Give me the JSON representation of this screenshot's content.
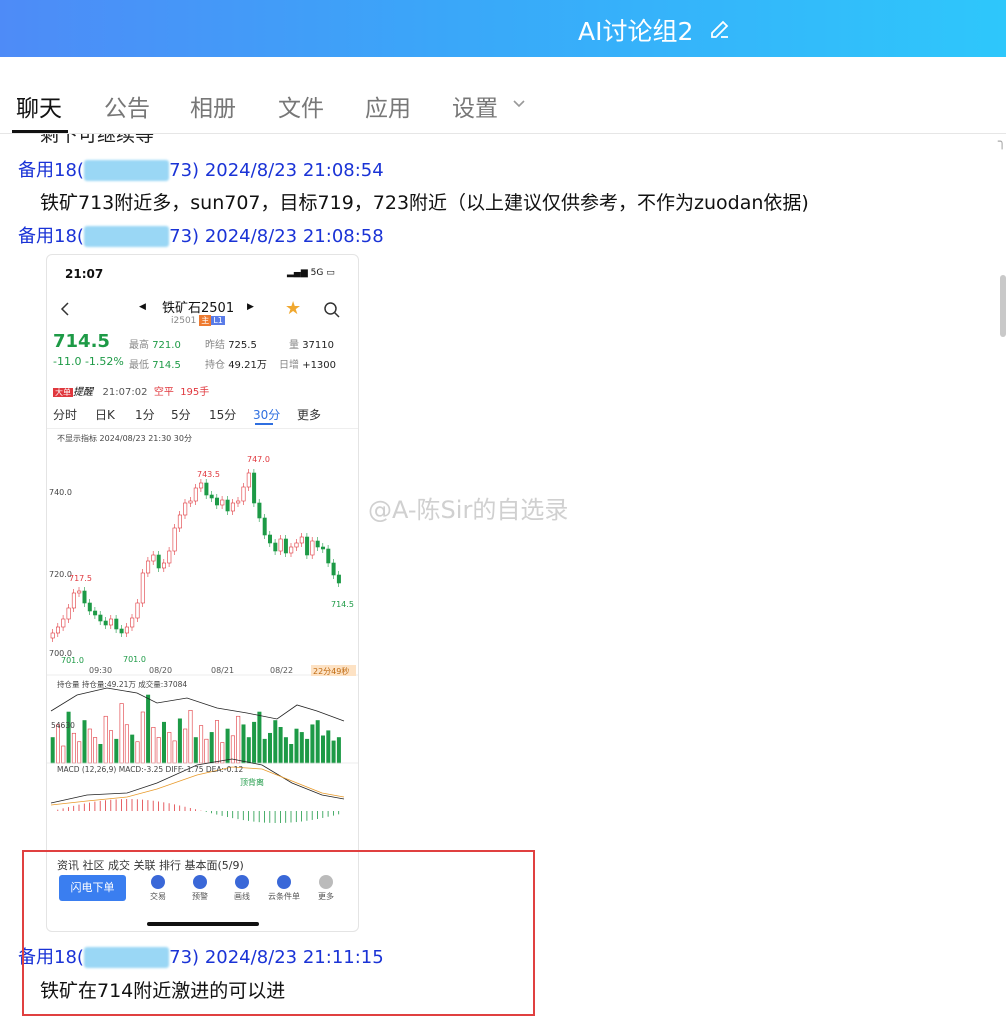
{
  "window": {
    "title": "AI讨论组2"
  },
  "tabs": [
    {
      "label": "聊天"
    },
    {
      "label": "公告"
    },
    {
      "label": "相册"
    },
    {
      "label": "文件"
    },
    {
      "label": "应用"
    },
    {
      "label": "设置"
    }
  ],
  "messages": [
    {
      "cut_text": "剩下可继续等"
    },
    {
      "sender_prefix": "备用18(",
      "sender_id_tail": "73)",
      "time": "2024/8/23 21:08:54",
      "text": "铁矿713附近多，sun707，目标719，723附近（以上建议仅供参考，不作为zuodan依据)"
    },
    {
      "sender_prefix": "备用18(",
      "sender_id_tail": "73)",
      "time": "2024/8/23 21:08:58"
    },
    {
      "sender_prefix": "备用18(",
      "sender_id_tail": "73)",
      "time": "2024/8/23 21:11:15",
      "text": "铁矿在714附近激进的可以进"
    }
  ],
  "phone": {
    "time": "21:07",
    "status_right": "5G",
    "symbol": "铁矿石2501",
    "code": "i2501",
    "code_tag1": "主",
    "code_tag2": "L1",
    "price": "714.5",
    "change": "-11.0  -1.52%",
    "stats": {
      "high_label": "最高",
      "high": "721.0",
      "low_label": "最低",
      "low": "714.5",
      "prev_label": "昨结",
      "prev": "725.5",
      "oi_label": "持仓",
      "oi": "49.21万",
      "vol_label": "量",
      "vol": "37110",
      "dinc_label": "日增",
      "dinc": "+1300"
    },
    "alert_badge": "大单",
    "alert_word": "提醒",
    "alert_time": "21:07:02",
    "alert_type": "空平",
    "alert_qty": "195手",
    "periods": [
      "分时",
      "日K",
      "1分",
      "5分",
      "15分",
      "30分",
      "更多"
    ],
    "indicator": "不显示指标  2024/08/23 21:30  30分",
    "chart_labels": {
      "y740": "740.0",
      "y720": "720.0",
      "y700": "700.0",
      "hi1": "743.5",
      "hi2": "747.0",
      "lo1": "717.5",
      "last": "714.5",
      "min1": "701.0",
      "min2": "701.0",
      "x1": "09:30",
      "x2": "08/20",
      "x3": "08/21",
      "x4": "08/22",
      "countdown": "22分49秒",
      "oi_header": "持仓量  持仓量:49.21万  成交量:37084",
      "oi_val": "54630",
      "macd_header": "MACD  (12,26,9)  MACD:-3.25  DIFF:-1.75  DEA:-0.12",
      "macd_note": "顶背离"
    },
    "bottom_tabs": "资讯    社区    成交    关联    排行    基本面(5/9)",
    "order_button": "闪电下单",
    "actions": [
      {
        "label": "交易"
      },
      {
        "label": "预警"
      },
      {
        "label": "画线"
      },
      {
        "label": "云条件单"
      },
      {
        "label": "更多"
      }
    ]
  },
  "watermark": "@A-陈Sir的自选录",
  "colors": {
    "title_gradient_start": "#4e8bf7",
    "title_gradient_end": "#2ec7fb",
    "sender": "#1a33d6",
    "highlight_box": "#e04040"
  }
}
